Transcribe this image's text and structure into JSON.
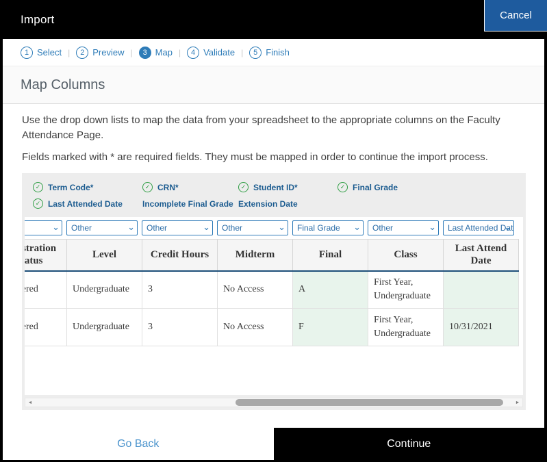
{
  "titlebar": {
    "title": "Import",
    "cancel_label": "Cancel"
  },
  "steps": {
    "divider": "|",
    "active_step": "Map",
    "items": [
      {
        "num": "1",
        "label": "Select"
      },
      {
        "num": "2",
        "label": "Preview"
      },
      {
        "num": "3",
        "label": "Map"
      },
      {
        "num": "4",
        "label": "Validate"
      },
      {
        "num": "5",
        "label": "Finish"
      }
    ]
  },
  "page": {
    "title": "Map Columns"
  },
  "instructions": {
    "p1": "Use the drop down lists to map the data from your spreadsheet to the appropriate columns on the Faculty Attendance Page.",
    "p2": "Fields marked with * are required fields. They must be mapped in order to continue the import process."
  },
  "mapping": {
    "items": [
      {
        "label": "Term Code*",
        "checked": true
      },
      {
        "label": "CRN*",
        "checked": true
      },
      {
        "label": "Student ID*",
        "checked": true
      },
      {
        "label": "Final Grade",
        "checked": true
      },
      {
        "label": "Last Attended Date",
        "checked": true
      },
      {
        "label": "Incomplete Final Grade",
        "checked": false
      },
      {
        "label": "Extension Date",
        "checked": false
      }
    ]
  },
  "dropdowns": [
    {
      "value": ""
    },
    {
      "value": "Other"
    },
    {
      "value": "Other"
    },
    {
      "value": "Other"
    },
    {
      "value": "Final Grade"
    },
    {
      "value": "Other"
    },
    {
      "value": "Last Attended Date"
    }
  ],
  "table": {
    "columns": [
      {
        "header": "Registration Status",
        "mapped": false
      },
      {
        "header": "Level",
        "mapped": false
      },
      {
        "header": "Credit Hours",
        "mapped": false
      },
      {
        "header": "Midterm",
        "mapped": false
      },
      {
        "header": "Final",
        "mapped": true
      },
      {
        "header": "Class",
        "mapped": false
      },
      {
        "header": "Last Attend Date",
        "mapped": true
      }
    ],
    "rows": [
      [
        "Registered",
        "Undergraduate",
        "3",
        "No Access",
        "A",
        "First Year, Undergraduate",
        ""
      ],
      [
        "Registered",
        "Undergraduate",
        "3",
        "No Access",
        "F",
        "First Year, Undergraduate",
        "10/31/2021"
      ]
    ]
  },
  "footer": {
    "go_back_label": "Go Back",
    "continue_label": "Continue"
  },
  "icons": {
    "check": "✓",
    "chevron_down": "⌄",
    "scroll_left": "◄",
    "scroll_right": "►"
  },
  "colors": {
    "accent_blue": "#2e7cb8",
    "cancel_blue": "#1e5b9e",
    "success_green": "#2f9e44",
    "mapped_cell_green": "#e8f4ec",
    "header_border_navy": "#1d4f79",
    "black": "#000000"
  }
}
